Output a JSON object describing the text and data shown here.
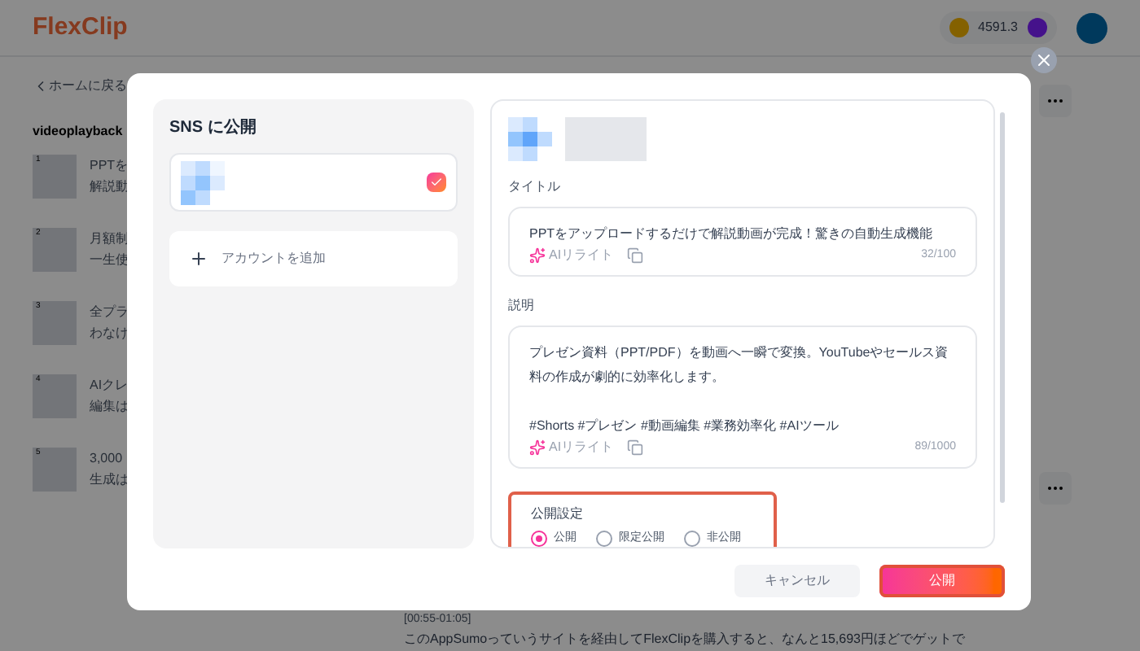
{
  "header": {
    "logo": "FlexClip",
    "credits": "4591.3"
  },
  "sidebar": {
    "back_link": "ホームに戻る",
    "project_title": "videoplayback",
    "items": [
      {
        "number": "1",
        "line_1": "PPTを",
        "line_2": "解説動"
      },
      {
        "number": "2",
        "line_1": "月額制",
        "line_2": "一生使"
      },
      {
        "number": "3",
        "line_1": "全プラ",
        "line_2": "わなけ"
      },
      {
        "number": "4",
        "line_1": "AIクレ",
        "line_2": "編集は"
      },
      {
        "number": "5",
        "line_1": "3,000",
        "line_2": "生成は"
      }
    ]
  },
  "transcript": {
    "timestamp": "[00:55-01:05]",
    "text": "このAppSumoっていうサイトを経由してFlexClipを購入すると、なんと15,693円ほどでゲットで"
  },
  "dialog": {
    "heading": "SNS に公開",
    "accounts": [
      {
        "checked": true
      }
    ],
    "add_account": "アカウントを追加",
    "title_label": "タイトル",
    "title_value": "PPTをアップロードするだけで解説動画が完成！驚きの自動生成機能",
    "title_ai": "AIリライト",
    "title_count": "32/100",
    "description_label": "説明",
    "description_value": "プレゼン資料（PPT/PDF）を動画へ一瞬で変換。YouTubeやセールス資料の作成が劇的に効率化します。\n\n#Shorts #プレゼン #動画編集 #業務効率化 #AIツール",
    "description_ai": "AIリライト",
    "description_count": "89/1000",
    "visibility_label": "公開設定",
    "visibility_options": [
      {
        "label": "公開",
        "selected": true
      },
      {
        "label": "限定公開",
        "selected": false
      },
      {
        "label": "非公開",
        "selected": false
      }
    ],
    "buttons": {
      "cancel": "キャンセル",
      "publish": "公開"
    }
  }
}
